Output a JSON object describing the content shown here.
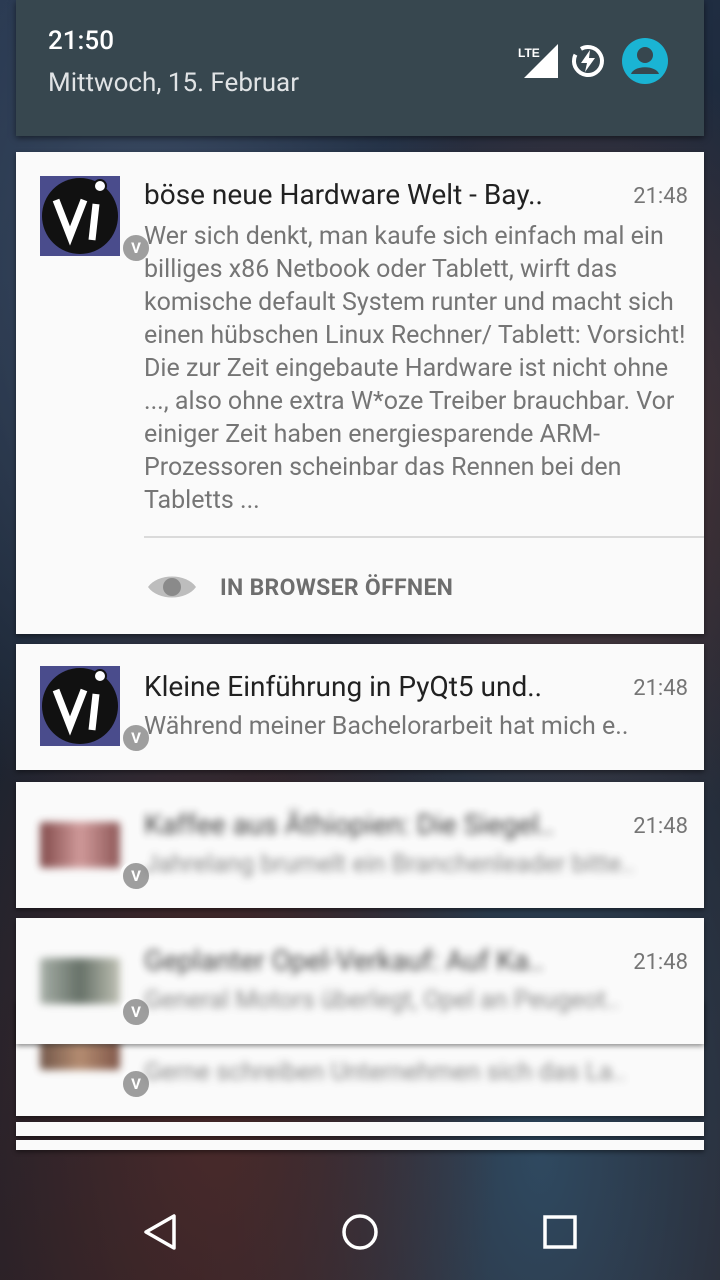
{
  "status": {
    "time": "21:50",
    "date": "Mittwoch, 15. Februar",
    "network": "LTE"
  },
  "notifications": [
    {
      "title": "böse neue Hardware Welt - Bay..",
      "time": "21:48",
      "text": "Wer sich denkt, man kaufe sich einfach mal ein billiges x86 Netbook oder Tablett, wirft das komische default System runter und macht sich einen hübschen Linux Rechner/ Tablett: Vorsicht! Die zur Zeit eingebaute Hardware ist nicht ohne ..., also ohne extra W*oze Treiber brauchbar. Vor einiger Zeit haben energiesparende ARM-Prozessoren scheinbar das Rennen bei den Tabletts ...",
      "action": "IN BROWSER ÖFFNEN"
    },
    {
      "title": "Kleine Einführung in PyQt5 und..",
      "time": "21:48",
      "text": "Während meiner Bachelorarbeit hat mich e.."
    },
    {
      "title": "Kaffee aus Äthiopien: Die Siegel..",
      "time": "21:48",
      "text": "Jahrelang brumelt ein Branchenleader bitte.."
    },
    {
      "title": "Geplanter Opel-Verkauf: Auf Ka..",
      "time": "21:48",
      "text": "General Motors überlegt, Opel an Peugeot.."
    },
    {
      "title": "",
      "time": "",
      "text": "Gerne schreiben Unternehmen sich das La.."
    }
  ],
  "badge_glyph": "V",
  "colors": {
    "qs_bg": "#37474f",
    "card_bg": "#fafafa",
    "avatar": "#1ab4d4"
  }
}
